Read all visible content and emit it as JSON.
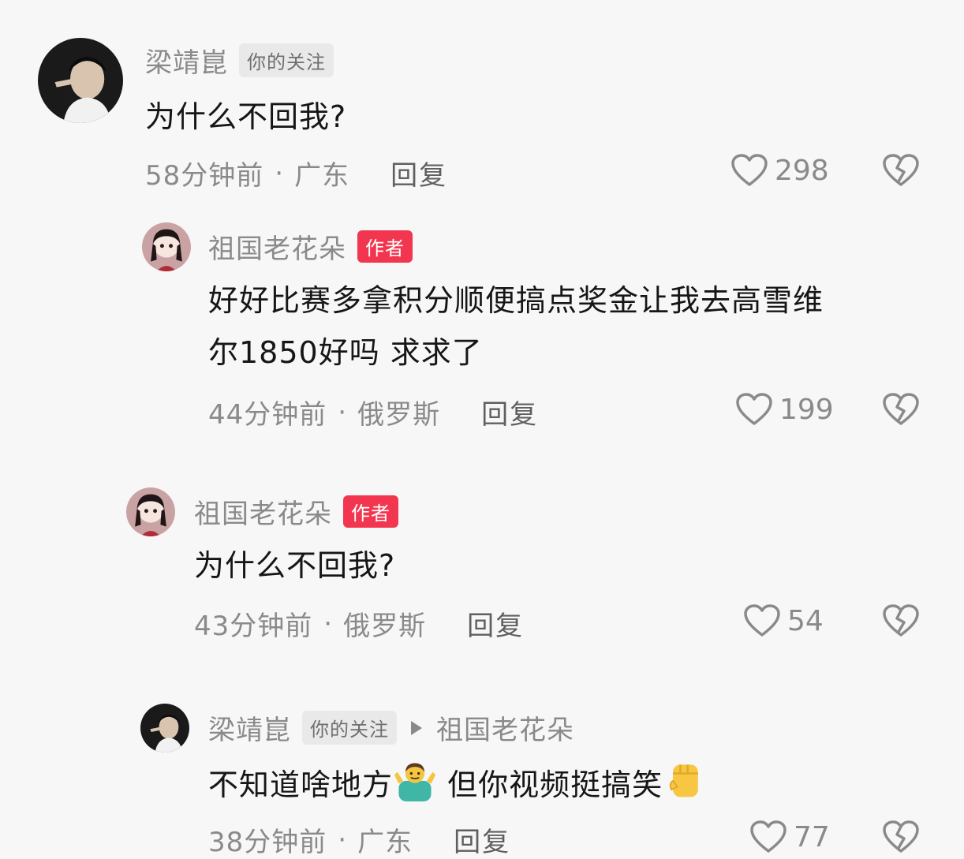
{
  "comments": [
    {
      "username": "梁靖崑",
      "tag": "你的关注",
      "text": "为什么不回我?",
      "time": "58分钟前",
      "location": "广东",
      "reply": "回复",
      "likes": "298"
    },
    {
      "username": "祖国老花朵",
      "tag": "作者",
      "text_line1": "好好比赛多拿积分顺便搞点奖金让我去高雪维",
      "text_line2": "尔1850好吗 求求了",
      "time": "44分钟前",
      "location": "俄罗斯",
      "reply": "回复",
      "likes": "199"
    },
    {
      "username": "祖国老花朵",
      "tag": "作者",
      "text": "为什么不回我?",
      "time": "43分钟前",
      "location": "俄罗斯",
      "reply": "回复",
      "likes": "54"
    },
    {
      "username": "梁靖崑",
      "tag": "你的关注",
      "reply_to": "祖国老花朵",
      "text_part1": "不知道啥地方",
      "text_part2": " 但你视频挺搞笑",
      "time": "38分钟前",
      "location": "广东",
      "reply": "回复",
      "likes": "77"
    }
  ],
  "separator": "·",
  "icons": {
    "like": "heart-outline-icon",
    "dislike": "broken-heart-icon"
  },
  "colors": {
    "author_tag": "#f2364f",
    "follow_tag": "#e9e9e9"
  }
}
